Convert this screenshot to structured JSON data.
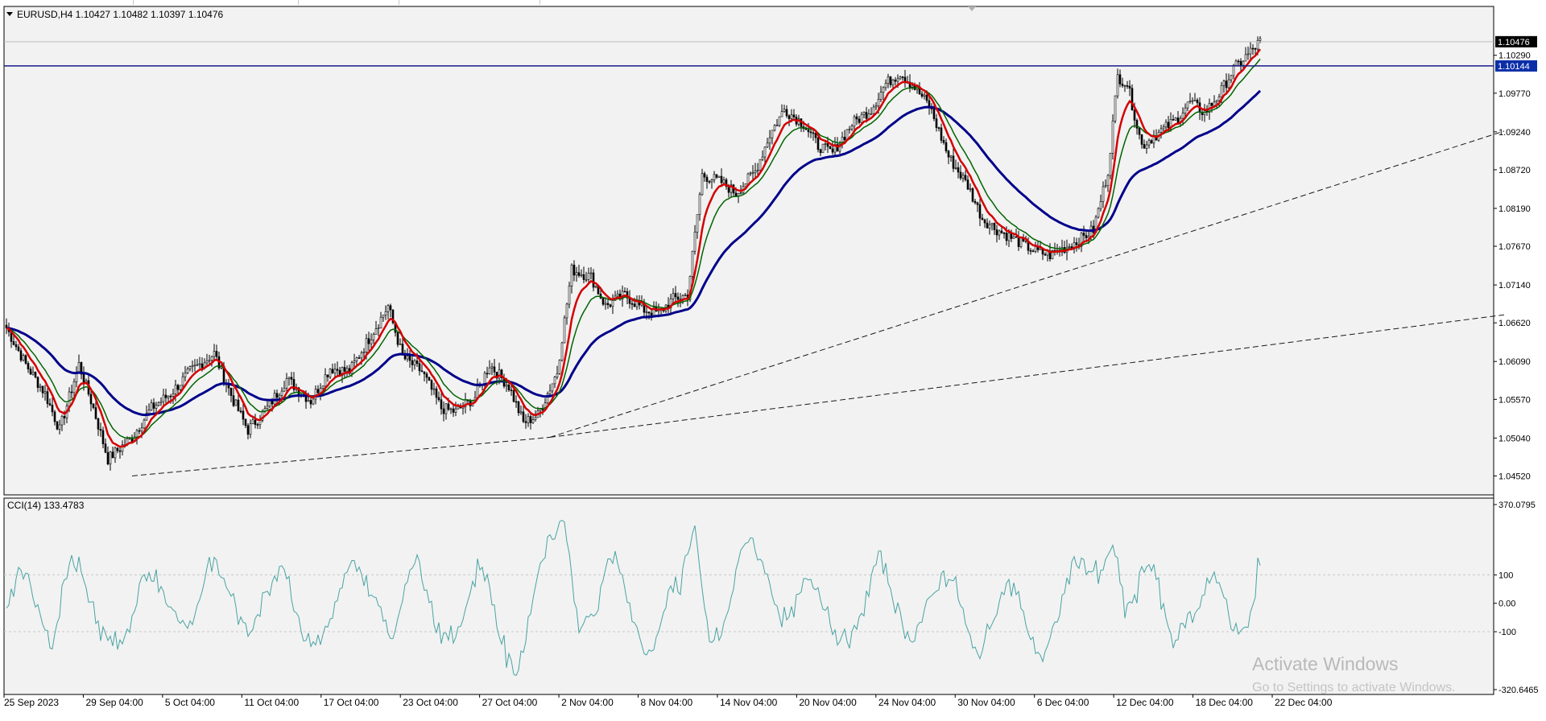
{
  "chart_data": [
    {
      "type": "candlestick",
      "title": "EURUSD,H4  1.10427 1.10482 1.10397 1.10476",
      "symbol": "EURUSD",
      "timeframe": "H4",
      "ohlc_header": {
        "open": "1.10427",
        "high": "1.10482",
        "low": "1.10397",
        "close": "1.10476"
      },
      "ylim": [
        1.0426,
        1.1096
      ],
      "y_ticks": [
        "1.10290",
        "1.09770",
        "1.09240",
        "1.08720",
        "1.08190",
        "1.07670",
        "1.07140",
        "1.06620",
        "1.06090",
        "1.05570",
        "1.05040",
        "1.04520"
      ],
      "x_ticks": [
        "25 Sep 2023",
        "29 Sep 04:00",
        "5 Oct 04:00",
        "11 Oct 04:00",
        "17 Oct 04:00",
        "23 Oct 04:00",
        "27 Oct 04:00",
        "2 Nov 04:00",
        "8 Nov 04:00",
        "14 Nov 04:00",
        "20 Nov 04:00",
        "24 Nov 04:00",
        "30 Nov 04:00",
        "6 Dec 04:00",
        "12 Dec 04:00",
        "18 Dec 04:00",
        "22 Dec 04:00"
      ],
      "current_price": "1.10476",
      "horizontal_line": {
        "label": "1.10144",
        "value": 1.10144,
        "color": "#1a1a8c"
      },
      "close_path_anchors": [
        [
          0,
          1.0655
        ],
        [
          8,
          1.0605
        ],
        [
          16,
          1.0565
        ],
        [
          22,
          1.0515
        ],
        [
          30,
          1.0605
        ],
        [
          36,
          1.0545
        ],
        [
          42,
          1.0475
        ],
        [
          52,
          1.0505
        ],
        [
          60,
          1.0545
        ],
        [
          68,
          1.0565
        ],
        [
          76,
          1.0595
        ],
        [
          86,
          1.062
        ],
        [
          94,
          1.0555
        ],
        [
          100,
          1.0515
        ],
        [
          108,
          1.0545
        ],
        [
          116,
          1.0585
        ],
        [
          126,
          1.0555
        ],
        [
          134,
          1.06
        ],
        [
          142,
          1.0595
        ],
        [
          150,
          1.064
        ],
        [
          158,
          1.0685
        ],
        [
          164,
          1.0615
        ],
        [
          172,
          1.0595
        ],
        [
          180,
          1.0545
        ],
        [
          186,
          1.054
        ],
        [
          194,
          1.056
        ],
        [
          200,
          1.0605
        ],
        [
          208,
          1.0575
        ],
        [
          214,
          1.0525
        ],
        [
          220,
          1.0535
        ],
        [
          228,
          1.0595
        ],
        [
          234,
          1.0735
        ],
        [
          242,
          1.0725
        ],
        [
          248,
          1.0685
        ],
        [
          256,
          1.07
        ],
        [
          264,
          1.068
        ],
        [
          270,
          1.0675
        ],
        [
          276,
          1.0695
        ],
        [
          282,
          1.07
        ],
        [
          288,
          1.0865
        ],
        [
          296,
          1.0855
        ],
        [
          302,
          1.084
        ],
        [
          310,
          1.087
        ],
        [
          316,
          1.092
        ],
        [
          322,
          1.0955
        ],
        [
          330,
          1.0935
        ],
        [
          336,
          1.0905
        ],
        [
          342,
          1.0895
        ],
        [
          350,
          1.0935
        ],
        [
          358,
          1.0955
        ],
        [
          364,
          1.099
        ],
        [
          370,
          1.1005
        ],
        [
          376,
          1.0985
        ],
        [
          382,
          1.096
        ],
        [
          390,
          1.089
        ],
        [
          398,
          1.085
        ],
        [
          404,
          1.0805
        ],
        [
          410,
          1.079
        ],
        [
          418,
          1.0775
        ],
        [
          426,
          1.076
        ],
        [
          432,
          1.0755
        ],
        [
          438,
          1.0765
        ],
        [
          444,
          1.0775
        ],
        [
          450,
          1.079
        ],
        [
          456,
          1.087
        ],
        [
          460,
          1.1
        ],
        [
          464,
          1.099
        ],
        [
          470,
          1.0905
        ],
        [
          476,
          1.092
        ],
        [
          484,
          1.094
        ],
        [
          490,
          1.0965
        ],
        [
          496,
          1.095
        ],
        [
          502,
          1.0975
        ],
        [
          508,
          1.101
        ],
        [
          514,
          1.103
        ],
        [
          519,
          1.1048
        ]
      ],
      "moving_averages": [
        {
          "period_hint": "fast",
          "color": "#d40000"
        },
        {
          "period_hint": "medium",
          "color": "#006400"
        },
        {
          "period_hint": "slow",
          "color": "#00008b"
        }
      ],
      "trendlines": [
        {
          "style": "dashed",
          "from": [
            52,
            1.0452
          ],
          "to": [
            225,
            1.0505
          ]
        },
        {
          "style": "dashed",
          "from": [
            225,
            1.0505
          ],
          "to": [
            620,
            1.0925
          ]
        },
        {
          "style": "dashed",
          "from": [
            225,
            1.0505
          ],
          "to": [
            620,
            1.0673
          ]
        }
      ]
    },
    {
      "type": "line",
      "title": "CCI(14) 133.4783",
      "indicator": "CCI(14)",
      "value": "133.4783",
      "ylim": [
        -320.6465,
        370.0795
      ],
      "y_ticks": [
        "370.0795",
        "100",
        "0.00",
        "-100",
        "-320.6465"
      ],
      "levels": [
        100,
        -100
      ],
      "color": "#4aa3a3"
    }
  ],
  "watermark": {
    "title": "Activate Windows",
    "subtitle": "Go to Settings to activate Windows."
  }
}
